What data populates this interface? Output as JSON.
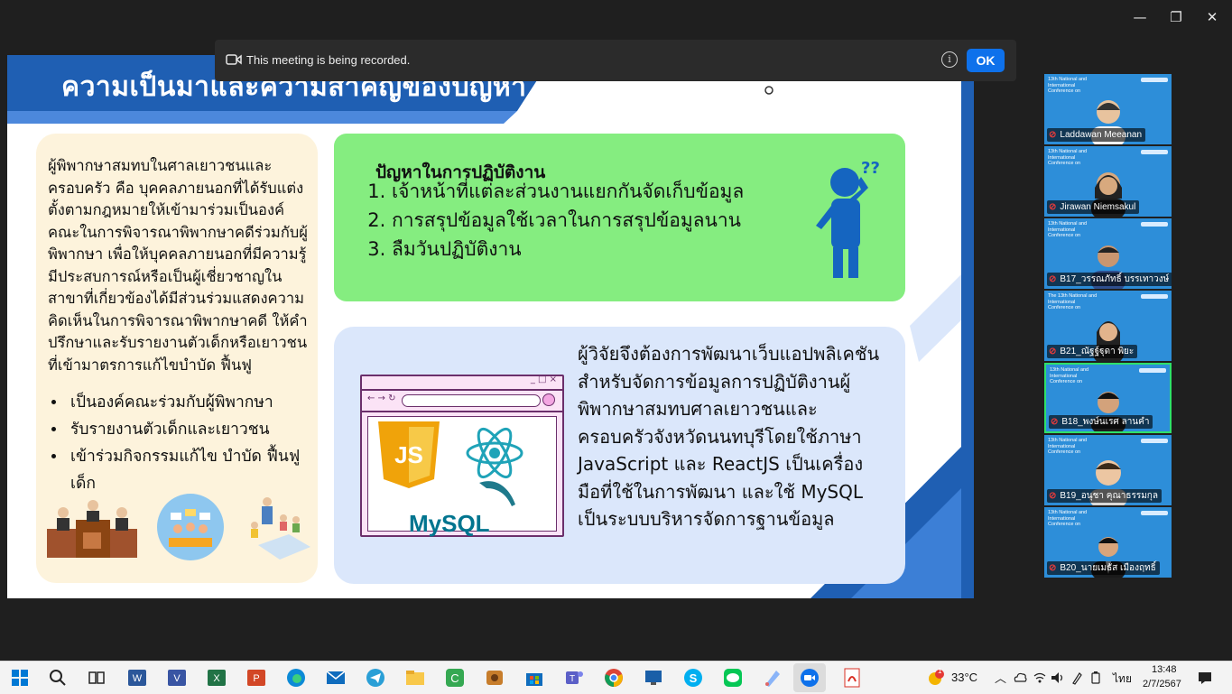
{
  "window": {
    "minimize": "—",
    "restore": "❐",
    "close": "✕"
  },
  "banner": {
    "message": "This meeting is being recorded.",
    "ok_label": "OK",
    "info_glyph": "i"
  },
  "slide": {
    "title": "ความเป็นมาและความสำคัญของปัญหา",
    "left_paragraph": "ผู้พิพากษาสมทบในศาลเยาวชนและครอบครัว คือ บุคคลภายนอกที่ได้รับแต่งตั้งตามกฎหมายให้เข้ามาร่วมเป็นองค์คณะในการพิจารณาพิพากษาคดีร่วมกับผู้พิพากษา เพื่อให้บุคคลภายนอกที่มีความรู้ มีประสบการณ์หรือเป็นผู้เชี่ยวชาญในสาขาที่เกี่ยวข้องได้มีส่วนร่วมแสดงความคิดเห็นในการพิจารณาพิพากษาคดี ให้คำปรึกษาและรับรายงานตัวเด็กหรือเยาวชนที่เข้ามาตรการแก้ไขบำบัด ฟื้นฟู",
    "bullets": [
      "เป็นองค์คณะร่วมกับผู้พิพากษา",
      "รับรายงานตัวเด็กและเยาวชน",
      "เข้าร่วมกิจกรรมแก้ไข บำบัด ฟื้นฟูเด็ก"
    ],
    "problems_title": "ปัญหาในการปฏิบัติงาน",
    "problems": [
      "เจ้าหน้าที่แต่ละส่วนงานแยกกันจัดเก็บข้อมูล",
      "การสรุปข้อมูลใช้เวลาในการสรุปข้อมูลนาน",
      "ลืมวันปฏิบัติงาน"
    ],
    "solution_text": "ผู้วิจัยจึงต้องการพัฒนาเว็บแอปพลิเคชันสำหรับจัดการข้อมูลการปฏิบัติงานผู้พิพากษาสมทบศาลเยาวชนและครอบครัวจังหวัดนนทบุรีโดยใช้ภาษา JavaScript และ ReactJS เป็นเครื่องมือที่ใช้ในการพัฒนา และใช้ MySQL เป็นระบบบริหารจัดการฐานข้อมูล",
    "question_marks": "??",
    "js_logo": "JS",
    "mysql_logo": "MySQL",
    "browser_controls": "_ □ ×",
    "browser_nav": "← → ↻"
  },
  "participants": [
    {
      "name": "Laddawan Meeanan",
      "conf": "13th National and International Conference on"
    },
    {
      "name": "Jirawan Niemsakul",
      "conf": "13th National and International Conference on"
    },
    {
      "name": "B17_วรรณภัทธิ์ บรรเทาวงษ์",
      "conf": "13th National and International Conference on"
    },
    {
      "name": "B21_ณัฐฐ์ฐุดา พิยะ",
      "conf": "The 13th National and International Conference on"
    },
    {
      "name": "B18_พงษ์นเรศ ลานคำ",
      "conf": "13th National and International Conference on"
    },
    {
      "name": "B19_อนุชา คุณาธรรมกุล",
      "conf": "13th National and International Conference on"
    },
    {
      "name": "B20_นายเมธัส เมืองฤทธิ์",
      "conf": "13th National and International Conference on"
    }
  ],
  "taskbar": {
    "weather": "33°C",
    "weather_badge": "1",
    "language": "ไทย",
    "time": "13:48",
    "date": "2/7/2567"
  },
  "colors": {
    "slide_blue": "#1f5fb3",
    "green_card": "#85ed80",
    "blue_card": "#dbe7fb",
    "beige_card": "#fdf3dc",
    "zoom_blue": "#0e71eb",
    "active_tile": "#2ee06a"
  }
}
